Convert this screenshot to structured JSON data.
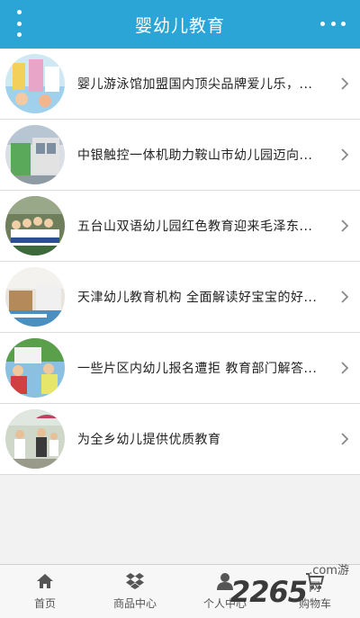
{
  "header": {
    "title": "婴幼儿教育",
    "left_icon": "vertical-dots-menu-icon",
    "right_icon": "horizontal-dots-more-icon",
    "color": "#2aa5d6"
  },
  "articles": [
    {
      "title": "婴儿游泳馆加盟国内顶尖品牌爱儿乐，..."
    },
    {
      "title": "中银触控一体机助力鞍山市幼儿园迈向..."
    },
    {
      "title": "五台山双语幼儿园红色教育迎来毛泽东..."
    },
    {
      "title": "天津幼儿教育机构 全面解读好宝宝的好..."
    },
    {
      "title": "一些片区内幼儿报名遭拒 教育部门解答..."
    },
    {
      "title": "为全乡幼儿提供优质教育"
    }
  ],
  "tabbar": {
    "items": [
      {
        "label": "首页",
        "icon": "home-icon"
      },
      {
        "label": "商品中心",
        "icon": "dropbox-box-icon"
      },
      {
        "label": "个人中心",
        "icon": "user-icon"
      },
      {
        "label": "购物车",
        "icon": "cart-icon"
      }
    ]
  },
  "watermark": {
    "number": "2265",
    "text": ".com游网"
  }
}
